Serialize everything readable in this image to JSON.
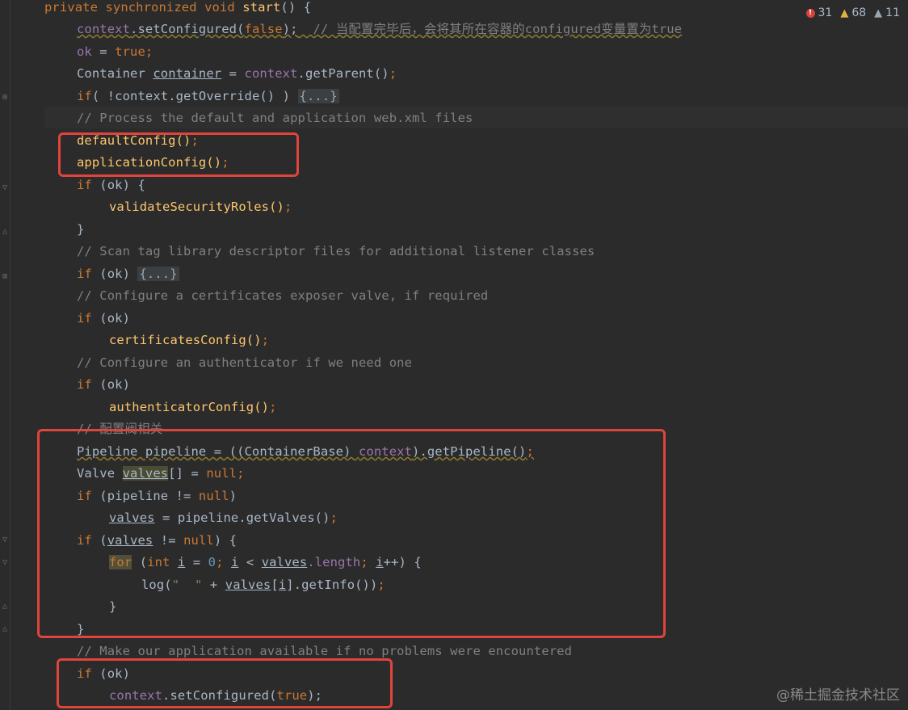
{
  "inspections": {
    "errors": "31",
    "warnings": "68",
    "weak_warnings": "11"
  },
  "watermark": "@稀土掘金技术社区",
  "code": {
    "l0": {
      "kw": "private synchronized void",
      "fn": "start",
      "rest": "() {"
    },
    "l1": {
      "obj": "context",
      "call": ".setConfigured(",
      "kw": "false",
      "rest": ");",
      "comment": "  // 当配置完毕后，会将其所在容器的configured变量置为true"
    },
    "l2": {
      "var": "ok",
      "eq": " = ",
      "kw": "true",
      "semi": ";"
    },
    "l3": {
      "type": "Container ",
      "var": "container",
      "eq": " = ",
      "obj": "context",
      "rest": ".getParent()",
      "semi": ";"
    },
    "l4": {
      "kw": "if",
      "rest": "( !context.getOverride() ) ",
      "fold": "{...}"
    },
    "l5": {
      "comment": "// Process the default and application web.xml files"
    },
    "l6": {
      "call": "defaultConfig()",
      "semi": ";"
    },
    "l7": {
      "call": "applicationConfig()",
      "semi": ";"
    },
    "l8": {
      "kw": "if",
      "rest": " (ok) {"
    },
    "l9": {
      "call": "validateSecurityRoles()",
      "semi": ";"
    },
    "l10": {
      "rest": "}"
    },
    "l11": {
      "comment": "// Scan tag library descriptor files for additional listener classes"
    },
    "l12": {
      "kw": "if",
      "rest": " (ok) ",
      "fold": "{...}"
    },
    "l13": {
      "comment": "// Configure a certificates exposer valve, if required"
    },
    "l14": {
      "kw": "if",
      "rest": " (ok)"
    },
    "l15": {
      "call": "certificatesConfig()",
      "semi": ";"
    },
    "l16": {
      "comment": "// Configure an authenticator if we need one"
    },
    "l17": {
      "kw": "if",
      "rest": " (ok)"
    },
    "l18": {
      "call": "authenticatorConfig()",
      "semi": ";"
    },
    "l19": {
      "comment": "// 配置阀相关"
    },
    "l20": {
      "a": "Pipeline pipeline = ((ContainerBase) ",
      "obj": "context",
      "b": ").getPipeline()",
      "semi": ";"
    },
    "l21": {
      "type": "Valve ",
      "var": "valves",
      "rest": "[] = ",
      "kw": "null",
      "semi": ";"
    },
    "l22": {
      "kw": "if",
      "rest": " (pipeline != ",
      "kw2": "null",
      "close": ")"
    },
    "l23": {
      "var": "valves",
      "rest": " = pipeline.getValves()",
      "semi": ";"
    },
    "l24": {
      "kw": "if",
      "open": " (",
      "var": "valves",
      "rest": " != ",
      "kw2": "null",
      "close": ") {"
    },
    "l25": {
      "kw": "for",
      "open": " (",
      "kw2": "int ",
      "i1": "i",
      "eq": " = ",
      "num": "0",
      "semi1": "; ",
      "i2": "i",
      "lt": " < ",
      "var": "valves",
      "fld": ".length",
      "semi2": "; ",
      "i3": "i",
      "inc": "++) {"
    },
    "l26": {
      "a": "log(",
      "str": "\"  \"",
      "b": " + ",
      "var": "valves",
      "c": "[",
      "i": "i",
      "d": "].getInfo())",
      "semi": ";"
    },
    "l27": {
      "rest": "}"
    },
    "l28": {
      "rest": "}"
    },
    "l29": {
      "comment": "// Make our application available if no problems were encountered"
    },
    "l30": {
      "kw": "if",
      "rest": " (ok)"
    },
    "l31": {
      "obj": "context",
      "call": ".setConfigured(",
      "kw": "true",
      "rest": ");"
    }
  }
}
